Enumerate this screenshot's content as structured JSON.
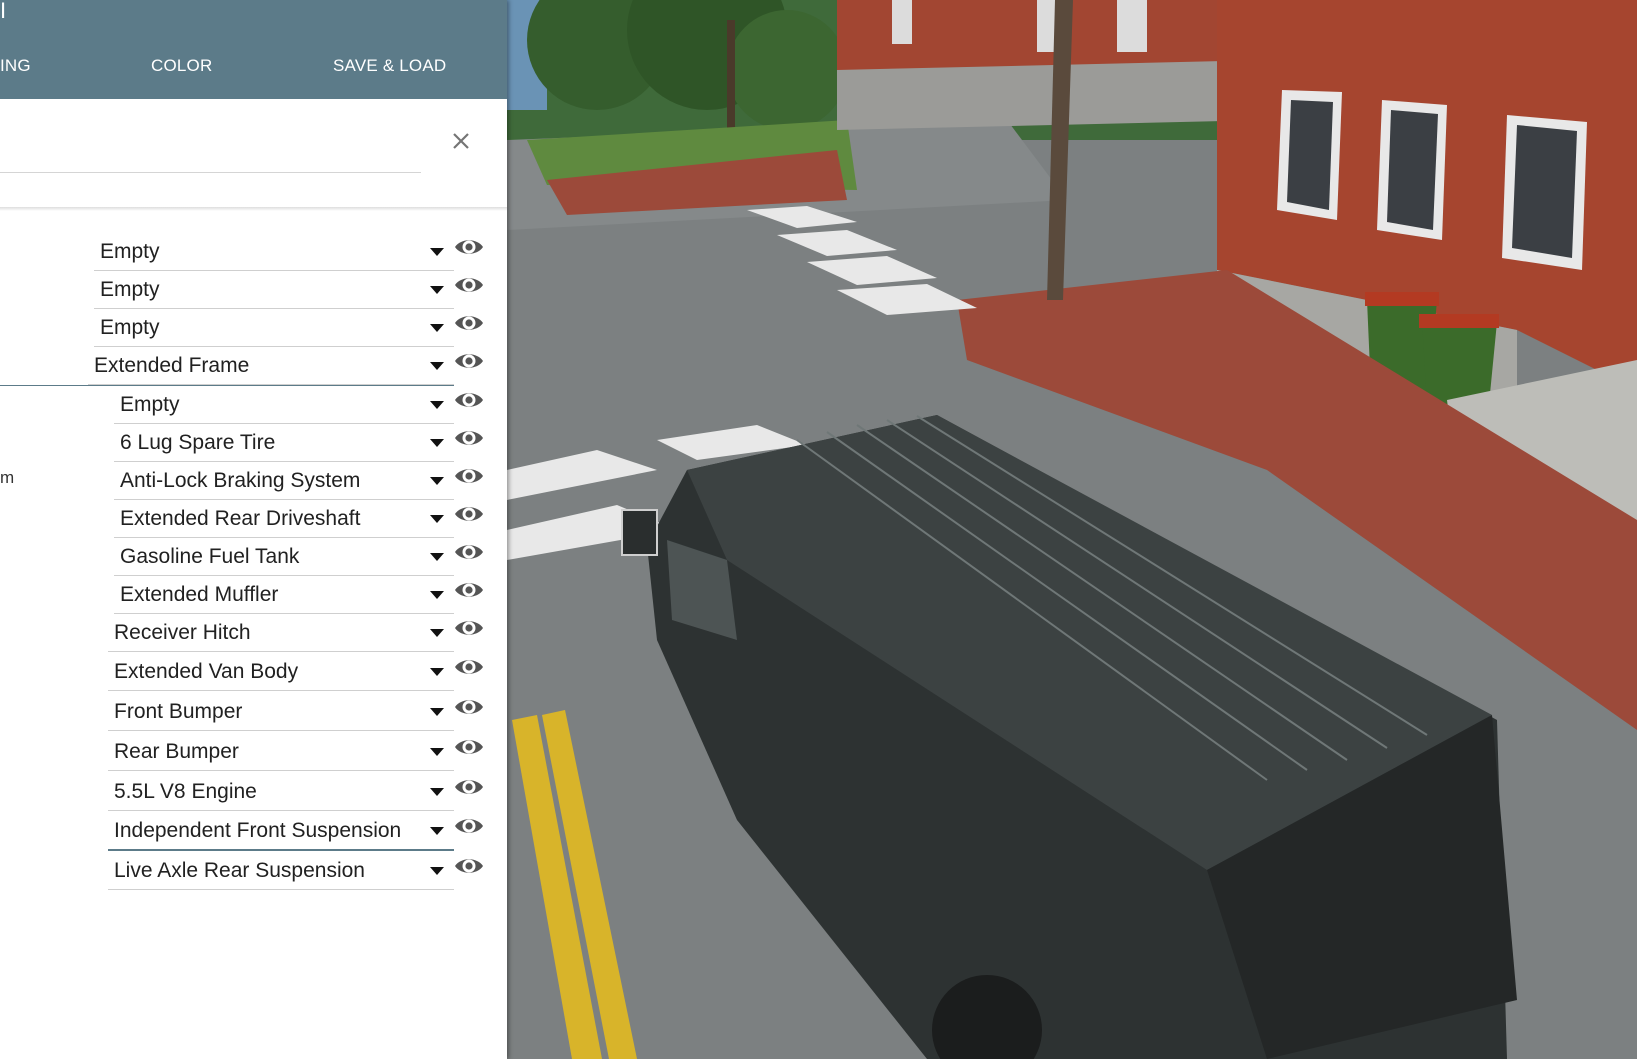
{
  "header": {
    "title_fragment": "I",
    "tabs": [
      {
        "label": "ING"
      },
      {
        "label": "COLOR"
      },
      {
        "label": "SAVE & LOAD"
      }
    ]
  },
  "slots": [
    {
      "label": "",
      "value": "Empty"
    },
    {
      "label": "",
      "value": "Empty"
    },
    {
      "label": "",
      "value": "Empty"
    },
    {
      "label": "",
      "value": "Extended Frame"
    },
    {
      "label": "",
      "value": "Empty"
    },
    {
      "label": "",
      "value": "6 Lug Spare Tire"
    },
    {
      "label": "m",
      "value": "Anti-Lock Braking System"
    },
    {
      "label": "",
      "value": "Extended Rear Driveshaft"
    },
    {
      "label": "",
      "value": "Gasoline Fuel Tank"
    },
    {
      "label": "",
      "value": "Extended Muffler"
    },
    {
      "label": "",
      "value": "Receiver Hitch"
    },
    {
      "label": "",
      "value": "Extended Van Body"
    },
    {
      "label": "",
      "value": "Front Bumper"
    },
    {
      "label": "",
      "value": "Rear Bumper"
    },
    {
      "label": "",
      "value": "5.5L V8 Engine"
    },
    {
      "label": "",
      "value": "Independent Front Suspension"
    },
    {
      "label": "",
      "value": "Live Axle Rear Suspension"
    }
  ],
  "icons": {
    "close": "close-icon",
    "visibility": "eye-icon",
    "dropdown": "caret-down-icon"
  },
  "colors": {
    "header_bg": "#5c7b89",
    "accent": "#5c7b89",
    "panel_bg": "#ffffff"
  }
}
